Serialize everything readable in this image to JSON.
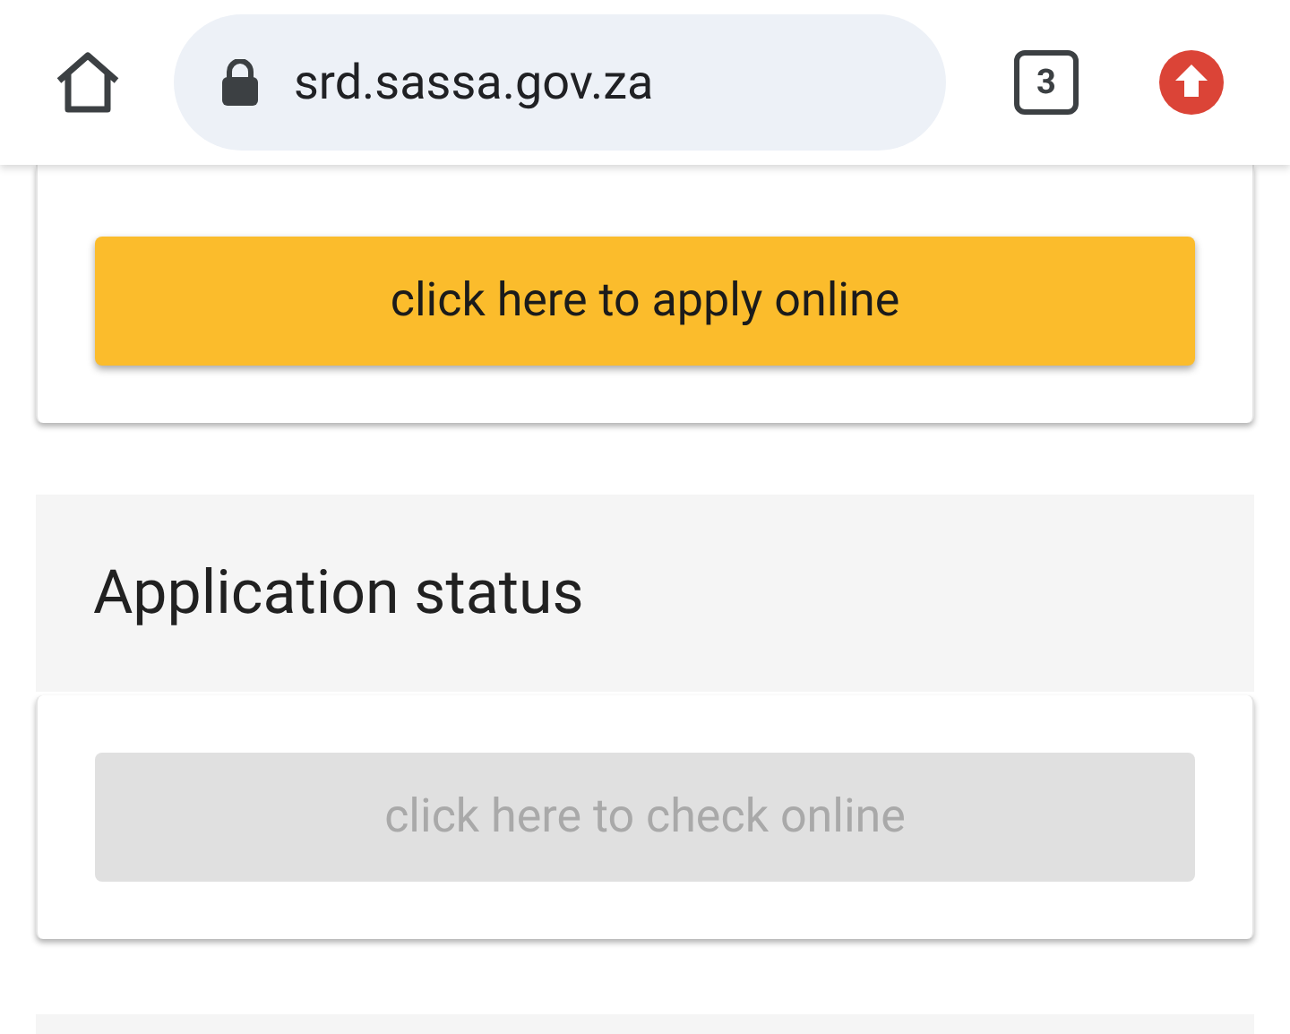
{
  "browser": {
    "url": "srd.sassa.gov.za",
    "tab_count": "3"
  },
  "apply_card": {
    "button": {
      "label": "click here to apply online",
      "disabled": false
    }
  },
  "status_section": {
    "title": "Application status",
    "button": {
      "label": "click here to check online",
      "disabled": true
    }
  }
}
